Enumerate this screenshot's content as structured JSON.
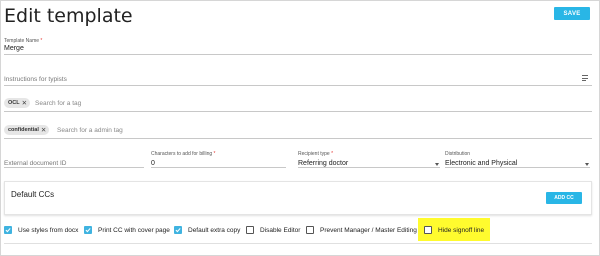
{
  "header": {
    "title": "Edit template",
    "save_label": "SAVE"
  },
  "template_name": {
    "label": "Template Name",
    "required": "*",
    "value": "Merge"
  },
  "instructions": {
    "placeholder": "Instructions for typists",
    "icon": "playlist-add-icon"
  },
  "tags": {
    "chip": "OCL",
    "placeholder": "Search for a tag"
  },
  "admin_tags": {
    "chip": "confidential",
    "placeholder": "Search for a admin tag"
  },
  "external_doc": {
    "placeholder": "External document ID"
  },
  "chars_billing": {
    "label": "Characters to add for billing",
    "required": "*",
    "value": "0"
  },
  "recipient_type": {
    "label": "Recipient type",
    "required": "*",
    "value": "Referring doctor"
  },
  "distribution": {
    "label": "Distribution",
    "value": "Electronic and Physical"
  },
  "default_ccs": {
    "title": "Default CCs",
    "add_label": "ADD CC"
  },
  "options": [
    {
      "label": "Use styles from docx",
      "checked": true
    },
    {
      "label": "Print CC with cover page",
      "checked": true
    },
    {
      "label": "Default extra copy",
      "checked": true
    },
    {
      "label": "Disable Editor",
      "checked": false
    },
    {
      "label": "Prevent Manager / Master Editing",
      "checked": false
    },
    {
      "label": "Hide signoff line",
      "checked": false
    }
  ],
  "colors": {
    "accent": "#29b6e6",
    "highlight": "#fffb2e",
    "required": "#e53935"
  }
}
